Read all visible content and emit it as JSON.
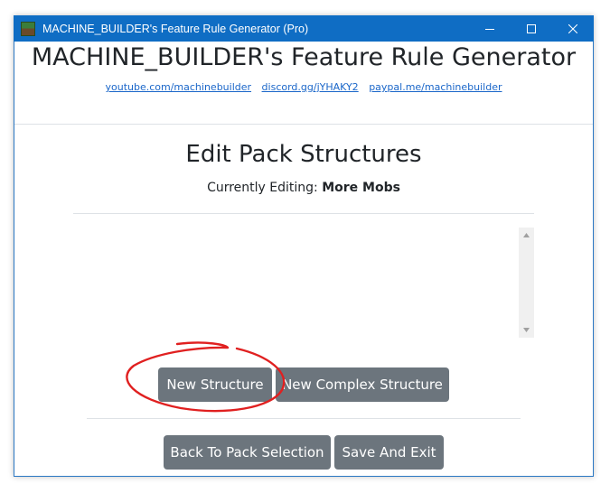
{
  "window": {
    "title": "MACHINE_BUILDER's Feature Rule Generator (Pro)",
    "controls": [
      "minimize-icon",
      "maximize-icon",
      "close-icon"
    ]
  },
  "header": {
    "title": "MACHINE_BUILDER's Feature Rule Generator",
    "links": [
      "youtube.com/machinebuilder",
      "discord.gg/jYHAKY2",
      "paypal.me/machinebuilder"
    ]
  },
  "main": {
    "title": "Edit Pack Structures",
    "editing_label": "Currently Editing:",
    "editing_value": "More Mobs",
    "structure_list": []
  },
  "buttons": {
    "new_structure": "New Structure",
    "new_complex_structure": "New Complex Structure",
    "back": "Back To Pack Selection",
    "save_exit": "Save And Exit"
  },
  "colors": {
    "titlebar": "#0f6dc4",
    "button": "#6c757d",
    "link": "#1a66c9",
    "annotation": "#e02020"
  }
}
